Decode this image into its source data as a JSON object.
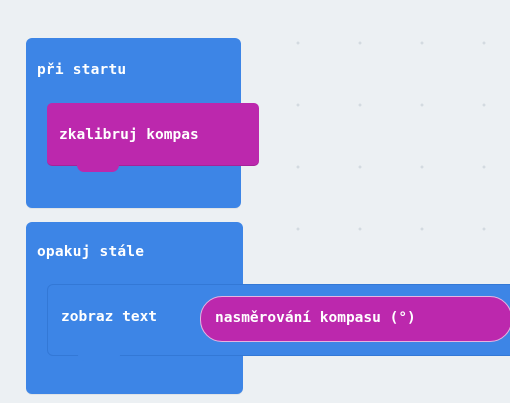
{
  "workspace": {
    "blocks": {
      "on_start": {
        "label": "při startu",
        "child": {
          "label": "zkalibruj kompas"
        }
      },
      "forever": {
        "label": "opakuj stále",
        "child": {
          "label": "zobraz text",
          "argument": {
            "label": "nasměrování kompasu (°)"
          }
        }
      }
    }
  },
  "colors": {
    "workspace_background": "#ecf0f3",
    "basic_category": "#3d85e6",
    "input_category": "#bc28ad"
  }
}
